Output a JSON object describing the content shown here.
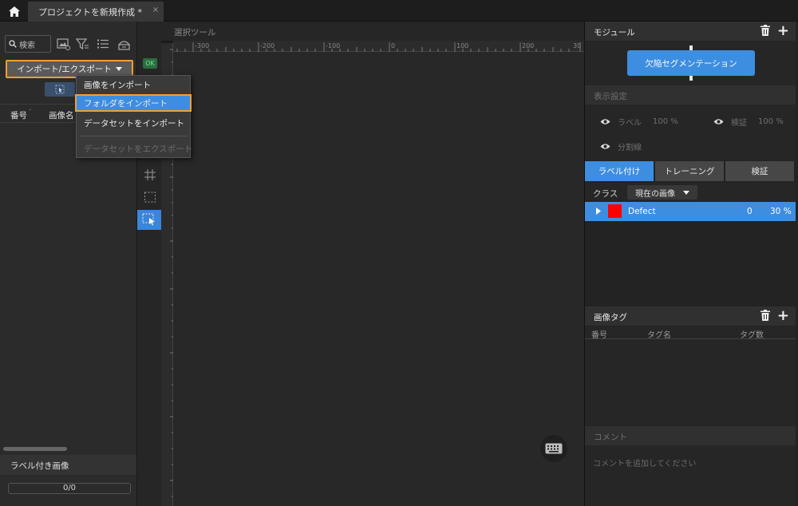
{
  "topbar": {
    "tab_title": "プロジェクトを新規作成 *",
    "tab_close": "×"
  },
  "left_panel": {
    "search_placeholder": "検索",
    "import_export_label": "インポート/エクスポート",
    "columns": {
      "number": "番号",
      "image_name": "画像名"
    },
    "labeled_section_title": "ラベル付き画像",
    "progress": "0/0"
  },
  "menu": {
    "items": [
      {
        "label": "画像をインポート",
        "enabled": true
      },
      {
        "label": "フォルダをインポート",
        "enabled": true,
        "highlighted": true
      },
      {
        "label": "データセットをインポート",
        "enabled": true
      },
      {
        "label": "データセットをエクスポート",
        "enabled": false
      }
    ]
  },
  "tool_strip": {
    "ok_badge": "OK"
  },
  "canvas": {
    "title": "選択ツール",
    "h_ticks": [
      "-300",
      "-200",
      "-100",
      "0",
      "100",
      "200",
      "30"
    ]
  },
  "right_panel": {
    "module_title": "モジュール",
    "module_button": "欠陥セグメンテーション",
    "display_title": "表示設定",
    "display": {
      "label_name": "ラベル",
      "label_value": "100 %",
      "verify_name": "検証",
      "verify_value": "100 %",
      "divider_name": "分割線"
    },
    "tabs": [
      {
        "label": "ラベル付け",
        "active": true
      },
      {
        "label": "トレーニング",
        "active": false
      },
      {
        "label": "検証",
        "active": false
      }
    ],
    "class_label": "クラス",
    "class_dropdown": "現在の画像",
    "classes": [
      {
        "name": "Defect",
        "count": "0",
        "percent": "30 %",
        "color": "#ff0000"
      }
    ],
    "tag_title": "画像タグ",
    "tag_columns": {
      "number": "番号",
      "tag_name": "タグ名",
      "tag_count": "タグ数"
    },
    "comment_title": "コメント",
    "comment_placeholder": "コメントを追加してください"
  },
  "colors": {
    "accent": "#3d8ee0",
    "highlight_border": "#f0a030",
    "defect": "#ff0000",
    "ok_green": "#2a6e40"
  },
  "icons": {
    "home": "home-icon",
    "search": "search-icon",
    "filter": "filter-icon",
    "trash": "trash-icon",
    "plus": "plus-icon",
    "eye": "eye-icon",
    "keyboard": "keyboard-icon"
  }
}
